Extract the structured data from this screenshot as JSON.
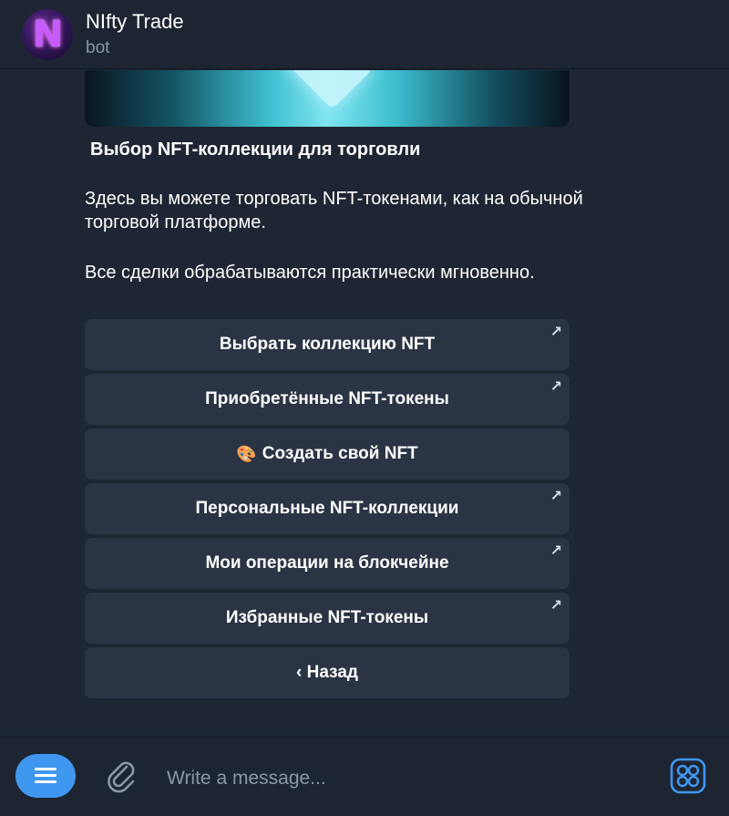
{
  "header": {
    "title": "NIfty Trade",
    "subtitle": "bot",
    "avatar_letter": "N"
  },
  "message": {
    "title": "Выбор NFT-коллекции для торговли",
    "paragraph1": "Здесь вы можете торговать NFT-токенами, как на обычной торговой платформе.",
    "paragraph2": "Все сделки обрабатываются практически мгновенно."
  },
  "keyboard": {
    "buttons": [
      {
        "label": "Выбрать коллекцию NFT",
        "has_arrow": true
      },
      {
        "label": "Приобретённые NFT-токены",
        "has_arrow": true
      },
      {
        "label": "Создать свой NFT",
        "emoji": "🎨",
        "has_arrow": false
      },
      {
        "label": "Персональные NFT-коллекции",
        "has_arrow": true
      },
      {
        "label": "Мои операции на блокчейне",
        "has_arrow": true
      },
      {
        "label": "Избранные NFT-токены",
        "has_arrow": true
      },
      {
        "label": "‹ Назад",
        "has_arrow": false
      }
    ],
    "arrow_glyph": "↗"
  },
  "composer": {
    "placeholder": "Write a message...",
    "menu_icon": "menu-icon",
    "attach_icon": "paperclip-icon",
    "apps_icon": "apps-grid-icon"
  },
  "colors": {
    "background": "#1e2633",
    "button": "#2a3444",
    "accent": "#3f97f0",
    "muted_text": "#8b97a6"
  }
}
